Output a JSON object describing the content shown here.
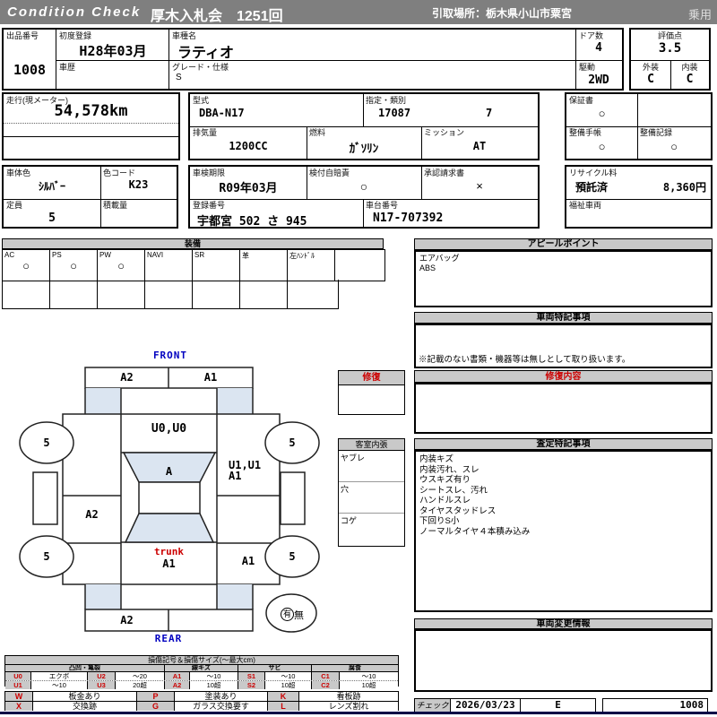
{
  "colors": {
    "accent_red": "#cc0000",
    "label_blue": "#0000c0",
    "shade_blue": "#dbe5f1",
    "header_gray": "#7f7f7f",
    "bar_gray": "#c9c9c9",
    "footer_navy": "#000046"
  },
  "header": {
    "logo": "Condition Check",
    "title": "厚木入札会　1251回",
    "pickup": "引取場所：栃木県小山市粟宮",
    "usage": "乗用"
  },
  "info": {
    "lot_label": "出品番号",
    "lot": "1008",
    "first_reg_label": "初度登録",
    "first_reg": "H28年03月",
    "history_label": "車歴",
    "history": "",
    "model_name_label": "車種名",
    "model_name": "ラティオ",
    "grade_label": "グレード・仕様",
    "grade": "S",
    "doors_label": "ドア数",
    "doors": "4",
    "drive_label": "駆動",
    "drive": "2WD",
    "score_label": "評価点",
    "score": "3.5",
    "exterior_label": "外装",
    "exterior": "C",
    "interior_label": "内装",
    "interior": "C",
    "mileage_label": "走行(現メーター)",
    "mileage": "54,578km",
    "model_code_label": "型式",
    "model_code": "DBA-N17",
    "type_class_label": "指定・類別",
    "type_no": "17087",
    "class_no": "7",
    "warranty_label": "保証書",
    "warranty": "○",
    "displacement_label": "排気量",
    "displacement": "1200CC",
    "fuel_label": "燃料",
    "fuel": "ｶﾞｿﾘﾝ",
    "transmission_label": "ミッション",
    "transmission": "AT",
    "maintenance_book_label": "整備手帳",
    "maintenance_book": "○",
    "maintenance_record_label": "整備記録",
    "maintenance_record": "○",
    "body_color_label": "車体色",
    "body_color": "ｼﾙﾊﾞｰ",
    "color_code_label": "色コード",
    "color_code": "K23",
    "inspection_label": "車検期限",
    "inspection": "R09年03月",
    "insurance_label": "検付自賠責",
    "insurance": "○",
    "approval_label": "承認請求書",
    "approval": "×",
    "recycle_label": "リサイクル料",
    "recycle_status": "預託済",
    "recycle_fee": "8,360円",
    "capacity_label": "定員",
    "capacity": "5",
    "load_label": "積載量",
    "load": "",
    "reg_no_label": "登録番号",
    "reg_no": "宇都宮  502  さ    945",
    "chassis_label": "車台番号",
    "chassis": "N17-707392",
    "welfare_label": "福祉車両",
    "welfare": ""
  },
  "equipment": {
    "title": "装備",
    "items": [
      {
        "label": "AC",
        "mark": "○"
      },
      {
        "label": "PS",
        "mark": "○"
      },
      {
        "label": "PW",
        "mark": "○"
      },
      {
        "label": "NAVI",
        "mark": ""
      },
      {
        "label": "SR",
        "mark": ""
      },
      {
        "label": "革",
        "mark": ""
      },
      {
        "label": "左ﾊﾝﾄﾞﾙ",
        "mark": ""
      },
      {
        "label": "",
        "mark": ""
      }
    ]
  },
  "diagram": {
    "front": "FRONT",
    "rear": "REAR",
    "marks": {
      "front_bumper_l": "A2",
      "front_bumper_r": "A1",
      "hood": "U0,U0",
      "windshield": "A",
      "right_front_1": "U1,U1",
      "right_front_2": "A1",
      "left_door": "A2",
      "trunk_word": "trunk",
      "trunk_mark": "A1",
      "right_rear": "A1",
      "rear_bumper_l": "A2",
      "tire_fl": "5",
      "tire_fr": "5",
      "tire_rl": "5",
      "tire_rr": "5",
      "spare_yes": "有",
      "spare_no": "無"
    },
    "repair_box_title": "修復",
    "cabin": {
      "title": "客室内張",
      "rows": [
        "ヤブレ",
        "穴",
        "コゲ"
      ]
    }
  },
  "panels": {
    "appeal": {
      "title": "アピールポイント",
      "lines": [
        "エアバッグ",
        "ABS"
      ]
    },
    "special": {
      "title": "車両特記事項",
      "note": "※記載のない書類・機器等は無しとして取り扱います。"
    },
    "repair": {
      "title": "修復内容"
    },
    "assessment": {
      "title": "査定特記事項",
      "lines": [
        "内装キズ",
        "内装汚れ、スレ",
        "ウスキズ有り",
        "シートスレ、汚れ",
        "ハンドルスレ",
        "タイヤスタッドレス",
        "下回りS小",
        "ノーマルタイヤ４本積み込み"
      ]
    },
    "change": {
      "title": "車両変更情報"
    }
  },
  "legend": {
    "title": "損傷記号＆損傷サイズ(〜最大cm)",
    "groups": [
      "凸凹・亀裂",
      "線キズ",
      "サビ",
      "腐食"
    ],
    "row1": [
      "U0",
      "エクボ",
      "U2",
      "〜20",
      "A1",
      "〜10",
      "S1",
      "〜10",
      "C1",
      "〜10"
    ],
    "row2": [
      "U1",
      "〜10",
      "U3",
      "20超",
      "A2",
      "10超",
      "S2",
      "10超",
      "C2",
      "10超"
    ],
    "row3": [
      "W",
      "板金あり",
      "P",
      "塗装あり",
      "K",
      "看板跡"
    ],
    "row4": [
      "X",
      "交換跡",
      "G",
      "ガラス交換要す",
      "L",
      "レンズ割れ"
    ]
  },
  "footer": {
    "check_label": "チェック",
    "check_date": "2026/03/23",
    "check_grade": "E",
    "check_lot": "1008"
  }
}
